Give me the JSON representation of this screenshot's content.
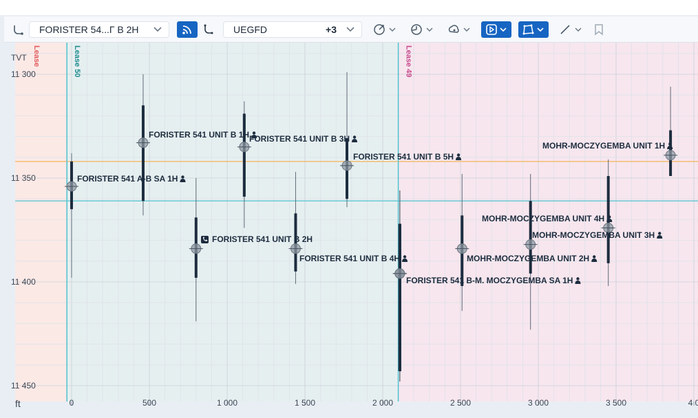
{
  "toolbar": {
    "well_select": "FORISTER 54...Г В 2Н",
    "formation_select": "UEGFD",
    "formation_extra": "+3",
    "icons": [
      "route-icon",
      "wifi-signal-icon",
      "well-path-icon",
      "chevron-down-icon",
      "target-icon",
      "clock-icon",
      "cloud-icon",
      "play-square-icon",
      "polygon-icon",
      "line-tool-icon",
      "bookmark-icon"
    ]
  },
  "chart": {
    "y_axis_title": "TVT",
    "x_unit": "ft",
    "y_ticks": [
      "11 300",
      "11 350",
      "11 400",
      "11 450"
    ],
    "x_ticks": [
      "0",
      "500",
      "1 000",
      "1 500",
      "2 000",
      "2 500",
      "3 000",
      "3 500",
      "4 0"
    ],
    "leases": [
      "Lease",
      "Lease 50",
      "Lease 49"
    ],
    "colors": {
      "lease_left_bg": "#fbe9e6",
      "lease50_bg": "#e6eff0",
      "lease49_bg": "#f7e6ee",
      "lease_line": "#4ec3d0",
      "ref_line_orange": "#f3b45a",
      "ref_line_cyan": "#4ec3d0",
      "bar": "#1d2d3f"
    }
  },
  "chart_data": {
    "type": "scatter",
    "xlabel": "ft",
    "ylabel": "TVT",
    "xlim": [
      -30,
      4000
    ],
    "ylim": [
      11291,
      11458
    ],
    "y_inverted": true,
    "reference_lines_y": [
      11342,
      11361
    ],
    "lease_boundaries_x": [
      -30,
      2100
    ],
    "series": [
      {
        "label": "FORISTER 541 A-B SA 1H",
        "icon": "person-icon",
        "x": 0,
        "y": 11354,
        "y_thick": [
          11342,
          11365
        ],
        "y_thin": [
          11338,
          11398
        ]
      },
      {
        "label": "FORISTER 541 UNIT B 1H",
        "icon": "person-icon",
        "x": 460,
        "y": 11333,
        "y_thick": [
          11315,
          11361
        ],
        "y_thin": [
          11300,
          11368
        ]
      },
      {
        "label": "FORISTER 541 UNIT B 2H",
        "icon": "phone-icon",
        "x": 800,
        "y": 11384,
        "y_thick": [
          11369,
          11398
        ],
        "y_thin": [
          11350,
          11419
        ]
      },
      {
        "label": "FORISTER 541 UNIT B 1H",
        "icon": "person-icon",
        "x": 1110,
        "y": 11335,
        "y_thick": [
          11319,
          11359
        ],
        "y_thin": [
          11313,
          11374
        ]
      },
      {
        "label": "FORISTER 541 UNIT B 2H",
        "icon": "person-icon",
        "x": 1440,
        "y": 11384,
        "y_thick": [
          11367,
          11395
        ],
        "y_thin": [
          11347,
          11401
        ]
      },
      {
        "label": "FORISTER 541 UNIT B 3H",
        "icon": "person-icon",
        "x": 1770,
        "y": 11344,
        "y_thick": [
          11331,
          11360
        ],
        "y_thin": [
          11299,
          11364
        ]
      },
      {
        "label": "FORISTER 541 UNIT B 4H",
        "icon": "person-icon",
        "x": 2110,
        "y": 11396,
        "y_thick": [
          11372,
          11443
        ],
        "y_thin": [
          11356,
          11448
        ]
      },
      {
        "label": "FORISTER 541 UNIT B 5H",
        "icon": "person-icon",
        "x": 2110,
        "y": 11396,
        "y_thick": [
          11372,
          11443
        ],
        "y_thin": [
          11356,
          11448
        ]
      },
      {
        "label": "FORISTER 541 B-M. MOCZYGEMBA SA 1H",
        "icon": "person-icon",
        "x": 2110,
        "y": 11396,
        "y_thick": [
          11372,
          11443
        ],
        "y_thin": [
          11356,
          11448
        ]
      },
      {
        "label": "MOHR-MOCZYGEMBA UNIT 2H",
        "icon": "person-icon",
        "x": 2510,
        "y": 11384,
        "y_thick": [
          11368,
          11402
        ],
        "y_thin": [
          11348,
          11414
        ]
      },
      {
        "label": "MOHR-MOCZYGEMBA UNIT 4H",
        "icon": "person-icon",
        "x": 2950,
        "y": 11382,
        "y_thick": [
          11361,
          11396
        ],
        "y_thin": [
          11348,
          11423
        ]
      },
      {
        "label": "MOHR-MOCZYGEMBA UNIT 3H",
        "icon": "person-icon",
        "x": 3450,
        "y": 11374,
        "y_thick": [
          11349,
          11391
        ],
        "y_thin": [
          11341,
          11402
        ]
      },
      {
        "label": "MOHR-MOCZYGEMBA UNIT 1H",
        "icon": "person-icon",
        "x": 3850,
        "y": 11339,
        "y_thick": [
          11327,
          11349
        ],
        "y_thin": [
          11306,
          11346
        ]
      }
    ]
  }
}
